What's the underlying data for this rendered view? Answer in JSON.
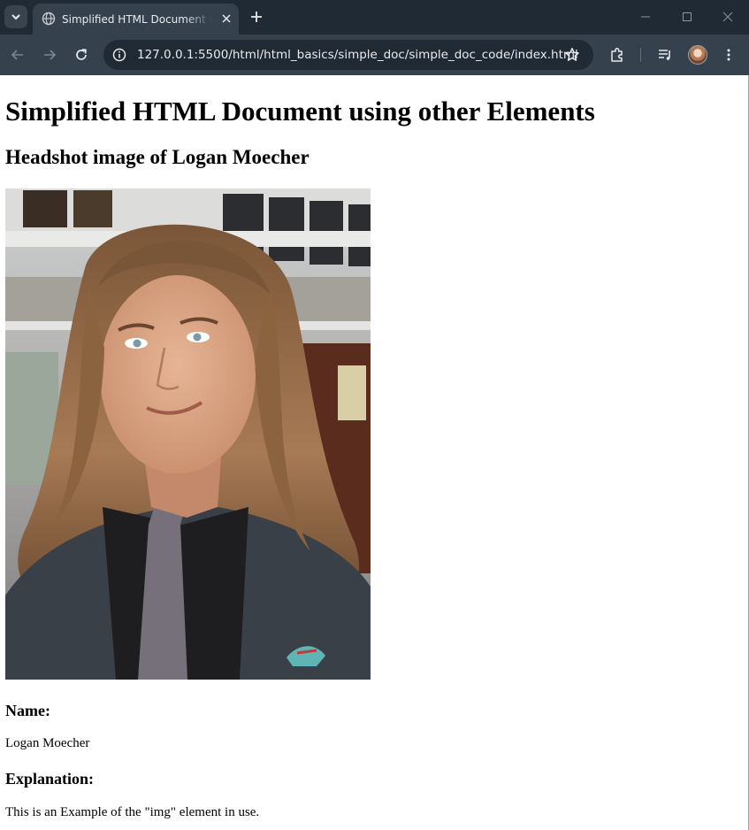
{
  "browser": {
    "tab_title": "Simplified HTML Document using other Elements",
    "url": "127.0.0.1:5500/html/html_basics/simple_doc/simple_doc_code/index.html",
    "icons": {
      "tab_search": "chevron-down-icon",
      "favicon": "globe-icon",
      "tab_close": "close-icon",
      "new_tab": "plus-icon",
      "minimize": "minimize-icon",
      "maximize": "maximize-icon",
      "close_window": "close-window-icon",
      "back": "back-arrow-icon",
      "forward": "forward-arrow-icon",
      "reload": "reload-icon",
      "site_info": "info-icon",
      "bookmark": "star-icon",
      "extensions": "puzzle-icon",
      "reading_list": "reading-list-icon",
      "menu": "kebab-menu-icon"
    },
    "colors": {
      "tabstrip": "#1f2a35",
      "toolbar": "#35414d",
      "omnibox": "#1f2a35",
      "text": "#e8eaed"
    }
  },
  "page": {
    "heading": "Simplified HTML Document using other Elements",
    "subheading": "Headshot image of Logan Moecher",
    "name_label": "Name:",
    "name_value": "Logan Moecher",
    "explanation_label": "Explanation:",
    "explanation_text": "This is an Example of the \"img\" element in use."
  }
}
